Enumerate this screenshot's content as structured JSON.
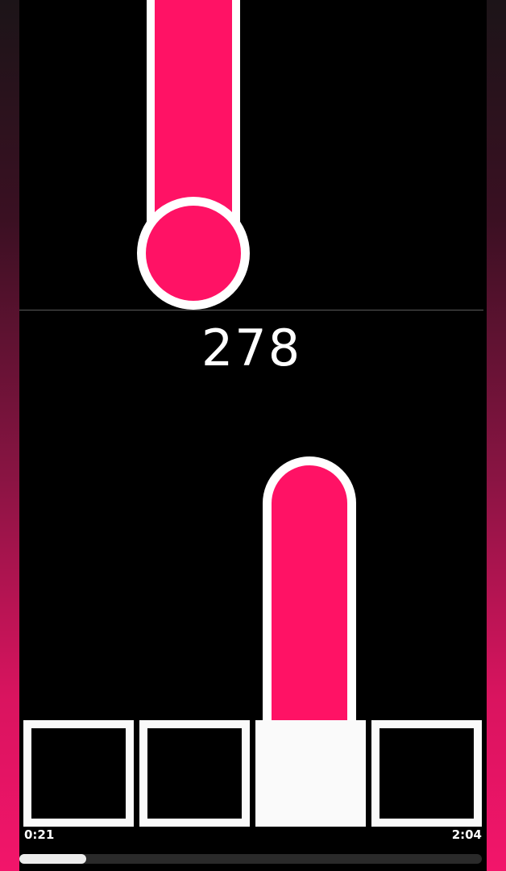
{
  "game": {
    "score": "278",
    "lanes": 4,
    "active_lane": 3,
    "note_color": "#ff1265",
    "outline_color": "#ffffff"
  },
  "playback": {
    "elapsed": "0:21",
    "duration": "2:04",
    "progress": 0.145
  }
}
